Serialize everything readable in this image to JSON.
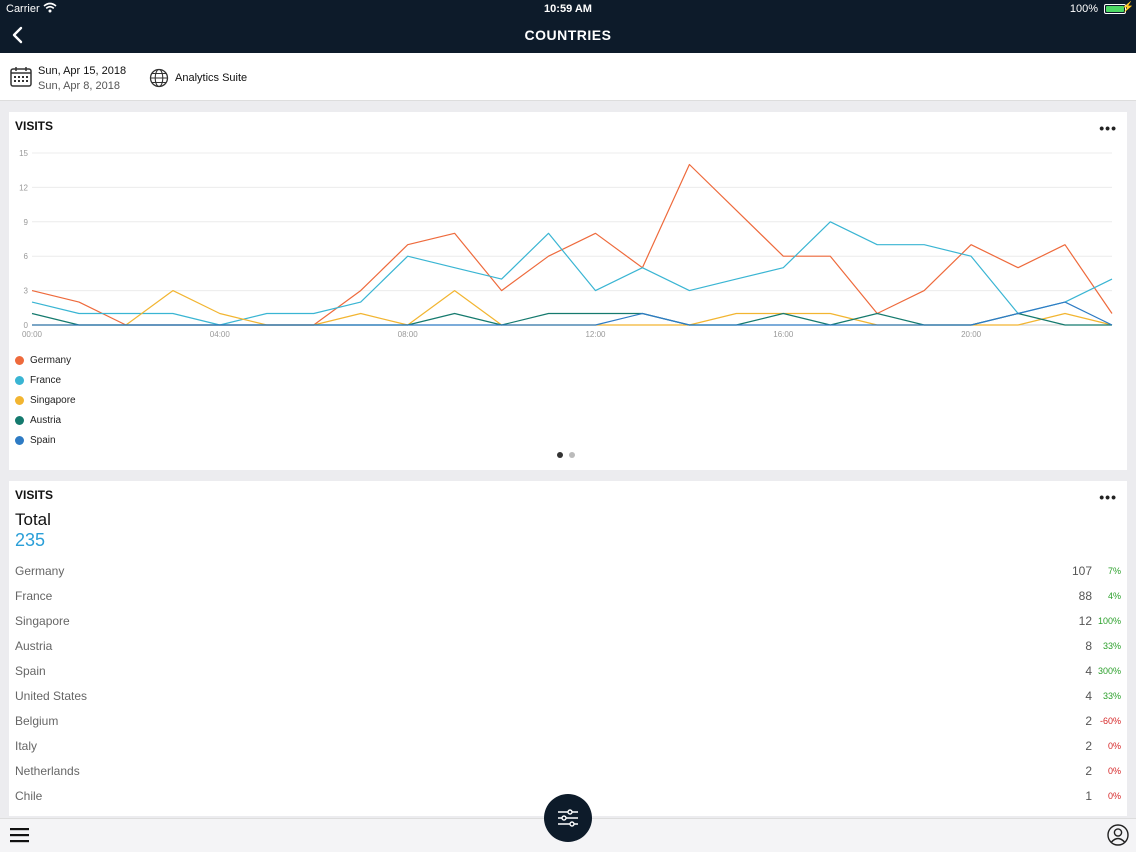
{
  "status_bar": {
    "carrier": "Carrier",
    "time": "10:59 AM",
    "battery": "100%"
  },
  "header": {
    "title": "COUNTRIES"
  },
  "filters": {
    "date_primary": "Sun, Apr 15, 2018",
    "date_secondary": "Sun, Apr 8, 2018",
    "suite": "Analytics Suite"
  },
  "visits_chart_card": {
    "title": "VISITS",
    "more": "•••"
  },
  "chart_data": {
    "type": "line",
    "title": "VISITS",
    "x": [
      "00:00",
      "01:00",
      "02:00",
      "03:00",
      "04:00",
      "05:00",
      "06:00",
      "07:00",
      "08:00",
      "09:00",
      "10:00",
      "11:00",
      "12:00",
      "13:00",
      "14:00",
      "15:00",
      "16:00",
      "17:00",
      "18:00",
      "19:00",
      "20:00",
      "21:00",
      "22:00",
      "23:00"
    ],
    "x_ticks": [
      "00:00",
      "04:00",
      "08:00",
      "12:00",
      "16:00",
      "20:00"
    ],
    "y_ticks": [
      0,
      3,
      6,
      9,
      12,
      15
    ],
    "ylim": [
      0,
      15
    ],
    "grid": true,
    "legend_position": "bottom-left",
    "series": [
      {
        "name": "Germany",
        "color": "#ee6a3c",
        "values": [
          3,
          2,
          0,
          0,
          0,
          0,
          0,
          3,
          7,
          8,
          3,
          6,
          8,
          5,
          14,
          10,
          6,
          6,
          1,
          3,
          7,
          5,
          7,
          1
        ]
      },
      {
        "name": "France",
        "color": "#3ab5d3",
        "values": [
          2,
          1,
          1,
          1,
          0,
          1,
          1,
          2,
          6,
          5,
          4,
          8,
          3,
          5,
          3,
          4,
          5,
          9,
          7,
          7,
          6,
          1,
          2,
          4
        ]
      },
      {
        "name": "Singapore",
        "color": "#f2b531",
        "values": [
          0,
          0,
          0,
          3,
          1,
          0,
          0,
          1,
          0,
          3,
          0,
          0,
          0,
          0,
          0,
          1,
          1,
          1,
          0,
          0,
          0,
          0,
          1,
          0
        ]
      },
      {
        "name": "Austria",
        "color": "#157a6e",
        "values": [
          1,
          0,
          0,
          0,
          0,
          0,
          0,
          0,
          0,
          1,
          0,
          1,
          1,
          1,
          0,
          0,
          1,
          0,
          1,
          0,
          0,
          1,
          0,
          0
        ]
      },
      {
        "name": "Spain",
        "color": "#2e7bc4",
        "values": [
          0,
          0,
          0,
          0,
          0,
          0,
          0,
          0,
          0,
          0,
          0,
          0,
          0,
          1,
          0,
          0,
          0,
          0,
          0,
          0,
          0,
          1,
          2,
          0
        ]
      }
    ]
  },
  "pager": {
    "pages": 2,
    "active": 0
  },
  "visits_table_card": {
    "title": "VISITS",
    "more": "•••",
    "total_label": "Total",
    "total_value": "235",
    "rows": [
      {
        "name": "Germany",
        "value": "107",
        "change": "7%",
        "trend": "pos"
      },
      {
        "name": "France",
        "value": "88",
        "change": "4%",
        "trend": "pos"
      },
      {
        "name": "Singapore",
        "value": "12",
        "change": "100%",
        "trend": "pos"
      },
      {
        "name": "Austria",
        "value": "8",
        "change": "33%",
        "trend": "pos"
      },
      {
        "name": "Spain",
        "value": "4",
        "change": "300%",
        "trend": "pos"
      },
      {
        "name": "United States",
        "value": "4",
        "change": "33%",
        "trend": "pos"
      },
      {
        "name": "Belgium",
        "value": "2",
        "change": "-60%",
        "trend": "neg"
      },
      {
        "name": "Italy",
        "value": "2",
        "change": "0%",
        "trend": "neg"
      },
      {
        "name": "Netherlands",
        "value": "2",
        "change": "0%",
        "trend": "neg"
      },
      {
        "name": "Chile",
        "value": "1",
        "change": "0%",
        "trend": "neg"
      }
    ]
  },
  "icons": {
    "back": "chevron-left-icon",
    "calendar": "calendar-icon",
    "globe": "globe-icon",
    "menu": "hamburger-menu-icon",
    "filter": "sliders-icon",
    "user": "user-profile-icon"
  }
}
